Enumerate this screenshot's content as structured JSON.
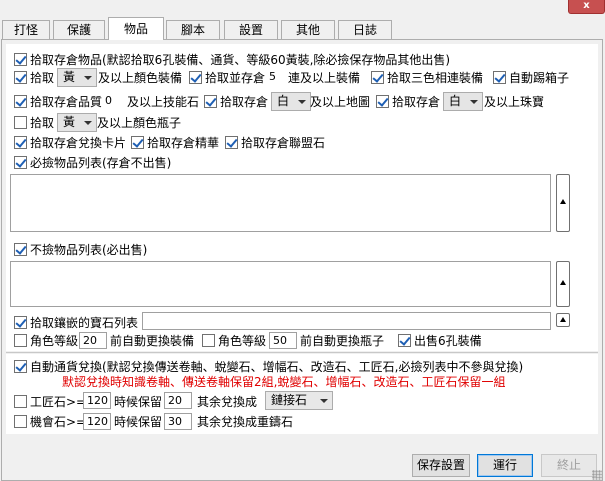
{
  "window": {
    "close_glyph": "x"
  },
  "tabs": [
    "打怪",
    "保護",
    "物品",
    "腳本",
    "設置",
    "其他",
    "日誌"
  ],
  "active_tab": "物品",
  "items": {
    "pickup_items": "拾取存倉物品(默認拾取6孔裝備、通貨、等級60黃裝,除必撿保存物品其他出售)",
    "pickup_color_label": "拾取",
    "pickup_color_value": "黃",
    "pickup_color_suffix": "及以上顏色裝備",
    "pickup_links_label": "拾取並存倉",
    "pickup_links_value": "5",
    "pickup_links_suffix": "連及以上裝備",
    "pickup_tricolor": "拾取三色相連裝備",
    "auto_kick_box": "自動踢箱子",
    "pickup_gem_label": "拾取存倉品質",
    "pickup_gem_value": "0",
    "pickup_gem_suffix": "及以上技能石",
    "pickup_map_label": "拾取存倉",
    "pickup_map_value": "白",
    "pickup_map_suffix": "及以上地圖",
    "pickup_jewel_label": "拾取存倉",
    "pickup_jewel_value": "白",
    "pickup_jewel_suffix": "及以上珠寶",
    "pickup_flask_label": "拾取",
    "pickup_flask_value": "黃",
    "pickup_flask_suffix": "及以上顏色瓶子",
    "pickup_cards": "拾取存倉兌換卡片",
    "pickup_essence": "拾取存倉精華",
    "pickup_alliance": "拾取存倉聯盟石",
    "must_pick_list": "必撿物品列表(存倉不出售)",
    "no_pick_list": "不撿物品列表(必出售)",
    "pickup_socketed": "拾取鑲嵌的寶石列表",
    "char_level_1_label": "角色等級",
    "char_level_1_value": "20",
    "char_level_1_suffix": "前自動更換裝備",
    "char_level_2_label": "角色等級",
    "char_level_2_value": "50",
    "char_level_2_suffix": "前自動更換瓶子",
    "sell_six_socket": "出售6孔裝備"
  },
  "currency": {
    "auto_exchange": "自動通貨兌換(默認兌換傳送卷軸、蛻變石、增幅石、改造石、工匠石,必撿列表中不參與兌換)",
    "note": "默認兌換時知識卷軸、傳送卷軸保留2組,蛻變石、增幅石、改造石、工匠石保留一組",
    "craft_label": "工匠石>=",
    "craft_threshold": "120",
    "craft_mid": "時候保留",
    "craft_keep": "20",
    "craft_suffix": "其余兌換成",
    "craft_target": "鏈接石",
    "chance_label": "機會石>=",
    "chance_threshold": "120",
    "chance_mid": "時候保留",
    "chance_keep": "30",
    "chance_suffix": "其余兌換成重鑄石"
  },
  "buttons": {
    "save": "保存設置",
    "run": "運行",
    "stop": "終止"
  },
  "colors": {
    "accent": "#0078d7",
    "note_red": "#e00000",
    "checkmark": "#1e5fb4"
  },
  "icons": {
    "checkbox": "checkmark-icon",
    "dropdown": "chevron-down-icon",
    "scroll": "scroll-up-icon"
  }
}
